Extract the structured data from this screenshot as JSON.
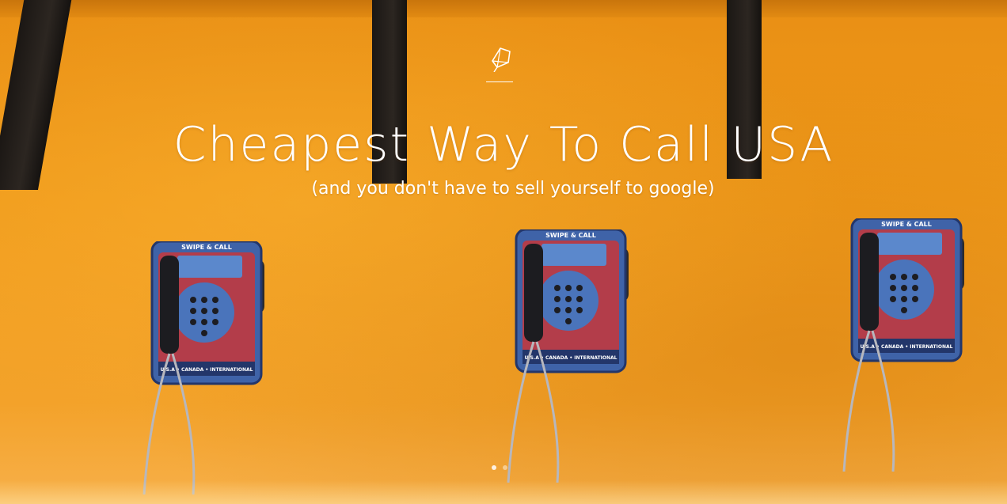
{
  "hero": {
    "title": "Cheapest Way To Call USA",
    "subtitle": "(and you don't have to sell yourself to google)",
    "slide_count": 2,
    "active_slide": 1
  },
  "payphone": {
    "header_label": "SWIPE & CALL",
    "footer_label": "U.S.A • CANADA • INTERNATIONAL"
  },
  "colors": {
    "wall": "#f09a1b",
    "phone_body": "#3f63a8",
    "phone_accent": "#c8363a",
    "text": "#ffffff"
  }
}
